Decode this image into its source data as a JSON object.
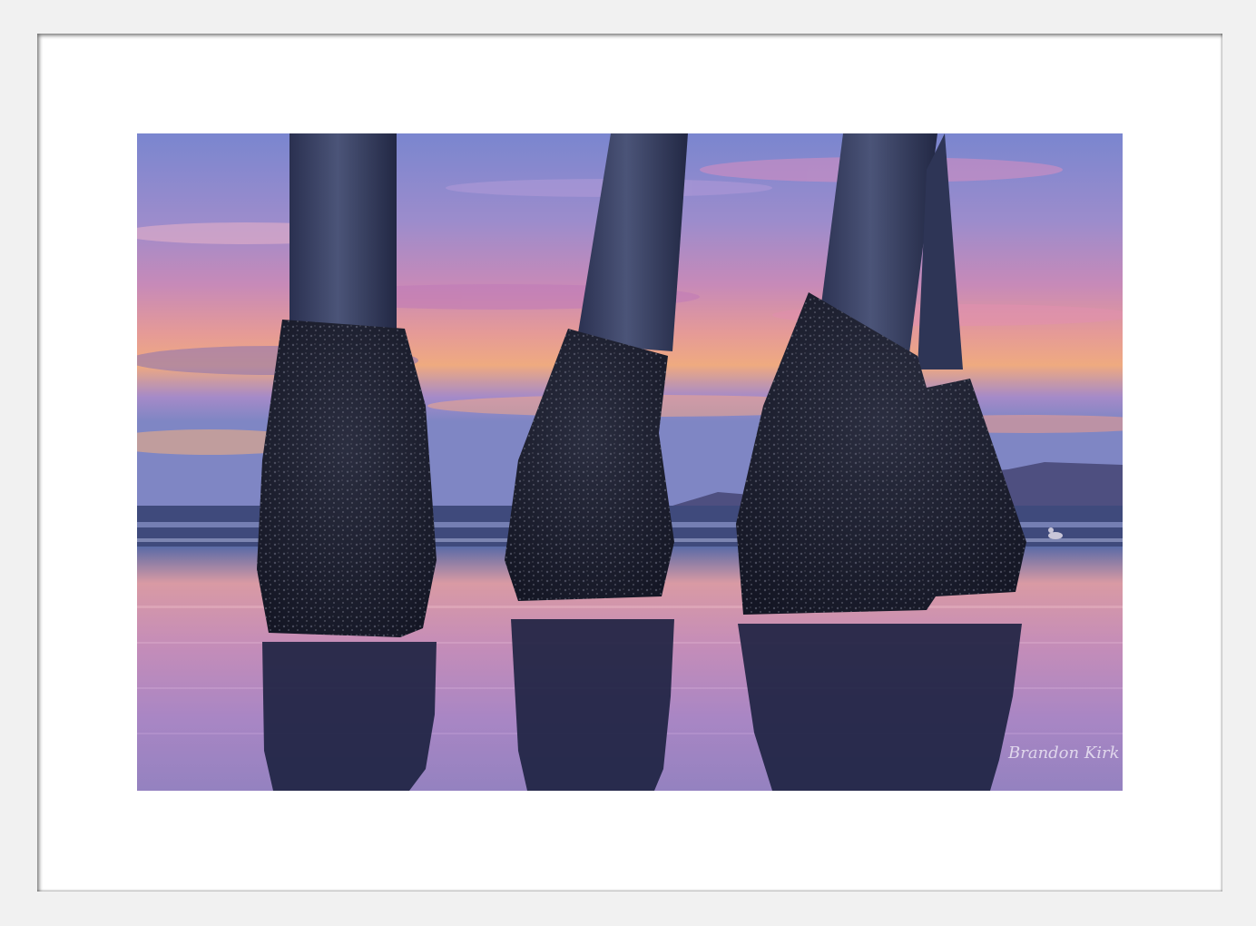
{
  "photo": {
    "subject": "",
    "signature": "Brandon Kirk"
  },
  "colors": {
    "frame": "#f1f1f1",
    "mat": "#ffffff",
    "sky_top": "#7f8ad0",
    "sky_mid": "#c98bb6",
    "sky_glow": "#f0a77d",
    "water_reflect": "#b48bc0",
    "piling": "#1d2236"
  }
}
